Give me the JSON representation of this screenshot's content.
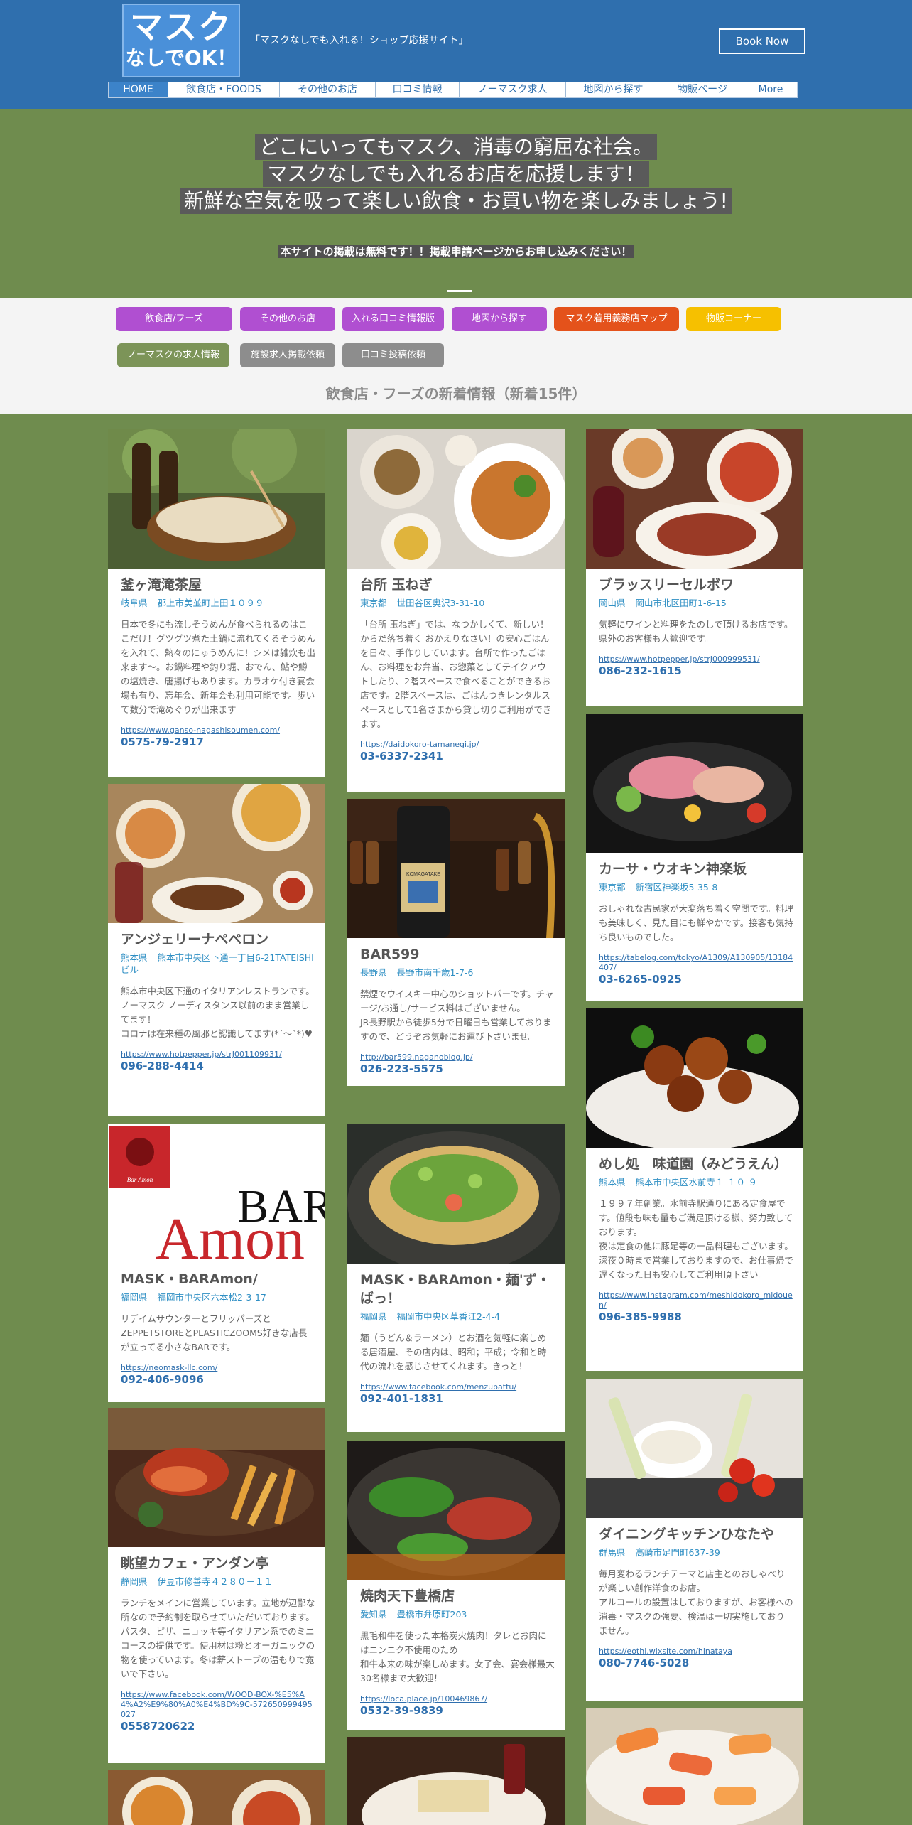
{
  "header": {
    "logo_line1": "マスク",
    "logo_line2": "なしでOK！",
    "tagline": "「マスクなしでも入れる！ショップ応援サイト」",
    "book_now": "Book Now",
    "nav": [
      "HOME",
      "飲食店・FOODS",
      "その他のお店",
      "口コミ情報",
      "ノーマスク求人",
      "地図から探す",
      "物販ページ",
      "More"
    ]
  },
  "hero": {
    "lines": [
      "どこにいってもマスク、消毒の窮屈な社会。",
      "マスクなしでも入れるお店を応援します！",
      "新鮮な空気を吸って楽しい飲食・お買い物を楽しみましょう!"
    ],
    "note": "本サイトの掲載は無料です！！掲載申請ページからお申し込みください！"
  },
  "categories": [
    {
      "label": "飲食店/フーズ",
      "color": "#b04fd1"
    },
    {
      "label": "その他のお店",
      "color": "#b04fd1"
    },
    {
      "label": "入れる口コミ情報版",
      "color": "#b04fd1"
    },
    {
      "label": "地図から探す",
      "color": "#b04fd1"
    },
    {
      "label": "マスク着用義務店マップ",
      "color": "#e4521b"
    },
    {
      "label": "物販コーナー",
      "color": "#f6c000"
    },
    {
      "label": "ノーマスクの求人情報",
      "color": "#7c9458"
    },
    {
      "label": "施設求人掲載依頼",
      "color": "#8d8d8d"
    },
    {
      "label": "口コミ投稿依頼",
      "color": "#8d8d8d"
    }
  ],
  "section_title": "飲食店・フーズの新着情報（新着15件）",
  "cards": [
    {
      "title": "釜ヶ滝滝茶屋",
      "pref": "岐阜県",
      "addr": "郡上市美並町上田１０９９",
      "desc": "日本で冬にも流しそうめんが食べられるのはここだけ！グツグツ煮た土鍋に流れてくるそうめんを入れて、熱々のにゅうめんに！シメは雑炊も出来ます〜。お鍋料理や釣り堀、おでん、鮎や鱒の塩焼き、唐揚げもあります。カラオケ付き宴会場も有り、忘年会、新年会も利用可能です。歩いて数分で滝めぐりが出来ます",
      "url": "https://www.ganso-nagashisoumen.com/",
      "tel": "0575-79-2917"
    },
    {
      "title": "アンジェリーナペペロン",
      "pref": "熊本県",
      "addr": "熊本市中央区下通一丁目6-21TATEISHIビル",
      "desc": "熊本市中央区下通のイタリアンレストランです。\nノーマスク ノーディスタンス以前のまま営業してます！\nコロナは在来種の風邪と認識してます(*´〜`*)♥",
      "url": "https://www.hotpepper.jp/strJ001109931/",
      "tel": "096-288-4414"
    },
    {
      "title": "MASK・BARAmon/",
      "pref": "福岡県",
      "addr": "福岡市中央区六本松2-3-17",
      "desc": "リデイムサウンターとフリッパーズとZEPPETSTOREとPLASTICZOOMS好きな店長が立ってる小さなBARです。",
      "url": "https://neomask-llc.com/",
      "tel": "092-406-9096",
      "logo_small": "Bar Amon",
      "logo_bar": "BAR",
      "logo_amon": "Amon"
    },
    {
      "title": "眺望カフェ・アンダン亭",
      "pref": "静岡県",
      "addr": "伊豆市修善寺４２８０－１１",
      "desc": "ランチをメインに営業しています。立地が辺鄙な所なので予約制を取らせていただいております。パスタ、ピザ、ニョッキ等イタリアン系でのミニコースの提供です。使用材は粉とオーガニックの物を使っています。冬は薪ストーブの温もりで寛いで下さい。",
      "url": "https://www.facebook.com/WOOD-BOX-%E5%A4%A2%E9%80%A0%E4%BD%9C-572650999495027",
      "tel": "0558720622"
    },
    {
      "title": "台所 玉ねぎ",
      "pref": "東京都",
      "addr": "世田谷区奥沢3-31-10",
      "desc": "「台所 玉ねぎ」では、なつかしくて、新しい！からだ落ち着く おかえりなさい！の安心ごはんを日々、手作りしています。台所で作ったごはん、お料理をお弁当、お惣菜としてテイクアウトしたり、2階スペースで食べることができるお店です。2階スペースは、ごはんつきレンタルスペースとして1名さまから貸し切りご利用ができます。",
      "url": "https://daidokoro-tamanegi.jp/",
      "tel": "03-6337-2341"
    },
    {
      "title": "BAR599",
      "pref": "長野県",
      "addr": "長野市南千歳1-7-6",
      "desc": "禁煙でウイスキー中心のショットバーです。チャージ/お通し/サービス料はございません。\nJR長野駅から徒歩5分で日曜日も営業しておりますので、どうぞお気軽にお運び下さいませ。",
      "url": "http://bar599.naganoblog.jp/",
      "tel": "026-223-5575",
      "bottle_label": "KOMAGATAKE"
    },
    {
      "title": "MASK・BARAmon・麺'ず・ばっ！",
      "pref": "福岡県",
      "addr": "福岡市中央区草香江2-4-4",
      "desc": "麺（うどん＆ラーメン）とお酒を気軽に楽しめる居酒屋、その店内は、昭和；平成；令和と時代の流れを感じさせてくれます。きっと！",
      "url": "https://www.facebook.com/menzubattu/",
      "tel": "092-401-1831"
    },
    {
      "title": "焼肉天下豊橋店",
      "pref": "愛知県",
      "addr": "豊橋市弁原町203",
      "desc": "黒毛和牛を使った本格炭火焼肉！タレとお肉にはニンニク不使用のため\n和牛本来の味が楽しめます。女子会、宴会様最大30名様まで大歓迎！",
      "url": "https://loca.place.jp/100469867/",
      "tel": "0532-39-9839"
    },
    {
      "title": "ブラッスリーセルボワ",
      "pref": "岡山県",
      "addr": "岡山市北区田町1-6-15",
      "desc": "気軽にワインと料理をたのしで頂けるお店です。\n県外のお客様も大歓迎です。",
      "url": "https://www.hotpepper.jp/strJ000999531/",
      "tel": "086-232-1615"
    },
    {
      "title": "カーサ・ウオキン神楽坂",
      "pref": "東京都",
      "addr": "新宿区神楽坂5-35-8",
      "desc": "おしゃれな古民家が大変落ち着く空間です。料理も美味しく、見た目にも鮮やかです。接客も気持ち良いものでした。",
      "url": "https://tabelog.com/tokyo/A1309/A130905/13184407/",
      "tel": "03-6265-0925"
    },
    {
      "title": "めし処　味道園（みどうえん）",
      "pref": "熊本県",
      "addr": "熊本市中央区水前寺１-１０-９",
      "desc": "１９９７年創業。水前寺駅通りにある定食屋です。値段も味も量もご満足頂ける様、努力致しております。\n夜は定食の他に豚足等の一品料理もございます。深夜０時まで営業しておりますので、お仕事帰で遅くなった日も安心してご利用頂下さい。",
      "url": "https://www.instagram.com/meshidokoro_midouen/",
      "tel": "096-385-9988"
    },
    {
      "title": "ダイニングキッチンひなたや",
      "pref": "群馬県",
      "addr": "高崎市足門町637-39",
      "desc": "毎月変わるランチテーマと店主とのおしゃべりが楽しい創作洋食のお店。\nアルコールの設置はしておりますが、お客様への消毒・マスクの強要、検温は一切実施しておりません。",
      "url": "https://eothi.wixsite.com/hinataya",
      "tel": "080-7746-5028"
    }
  ]
}
